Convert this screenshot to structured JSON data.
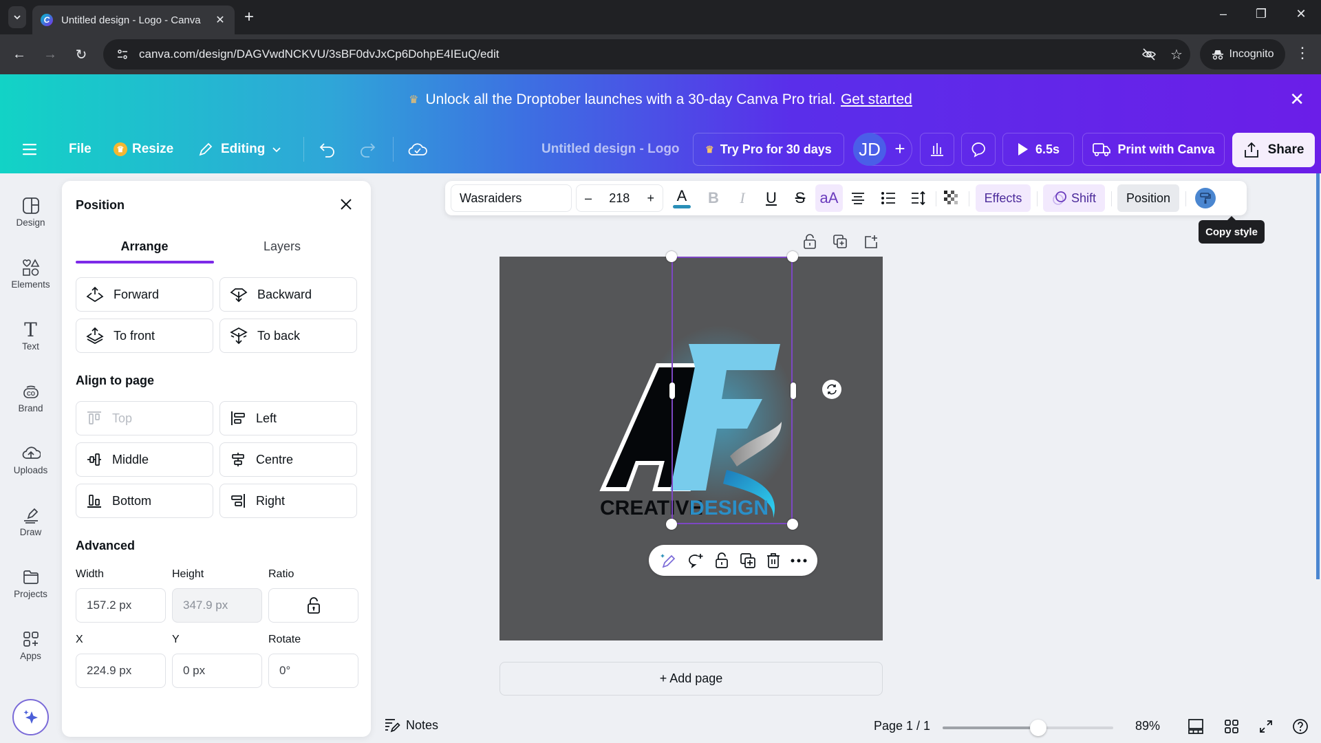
{
  "browser": {
    "tab_title": "Untitled design - Logo - Canva",
    "favicon_letter": "C",
    "url": "canva.com/design/DAGVwdNCKVU/3sBF0dvJxCp6DohpE4IEuQ/edit",
    "incognito_label": "Incognito"
  },
  "banner": {
    "text": "Unlock all the Droptober launches with a 30-day Canva Pro trial.",
    "link": "Get started"
  },
  "toolbar": {
    "file": "File",
    "resize": "Resize",
    "editing": "Editing",
    "doc_title": "Untitled design - Logo",
    "try_pro": "Try Pro for 30 days",
    "avatar_initials": "JD",
    "play_duration": "6.5s",
    "print": "Print with Canva",
    "share": "Share"
  },
  "rail": {
    "items": [
      {
        "label": "Design",
        "icon": "design-icon"
      },
      {
        "label": "Elements",
        "icon": "elements-icon"
      },
      {
        "label": "Text",
        "icon": "text-icon"
      },
      {
        "label": "Brand",
        "icon": "brand-icon"
      },
      {
        "label": "Uploads",
        "icon": "uploads-icon"
      },
      {
        "label": "Draw",
        "icon": "draw-icon"
      },
      {
        "label": "Projects",
        "icon": "projects-icon"
      },
      {
        "label": "Apps",
        "icon": "apps-icon"
      }
    ]
  },
  "panel": {
    "title": "Position",
    "tabs": [
      "Arrange",
      "Layers"
    ],
    "active_tab": "Arrange",
    "arrange": [
      "Forward",
      "Backward",
      "To front",
      "To back"
    ],
    "align_heading": "Align to page",
    "align": [
      "Top",
      "Left",
      "Middle",
      "Centre",
      "Bottom",
      "Right"
    ],
    "advanced_heading": "Advanced",
    "labels": {
      "width": "Width",
      "height": "Height",
      "ratio": "Ratio",
      "x": "X",
      "y": "Y",
      "rotate": "Rotate"
    },
    "values": {
      "width": "157.2 px",
      "height": "347.9 px",
      "x": "224.9 px",
      "y": "0 px",
      "rotate": "0°"
    }
  },
  "text_toolbar": {
    "font": "Wasraiders",
    "size": "218",
    "minus": "–",
    "plus": "+",
    "text_color": "#2a8fb8",
    "effects": "Effects",
    "shift": "Shift",
    "position": "Position",
    "tooltip": "Copy style"
  },
  "canvas": {
    "logo_text_dark": "CREATIVE",
    "logo_text_blue": "DESIGN",
    "add_page": "+ Add page"
  },
  "bottom": {
    "notes": "Notes",
    "page": "Page 1 / 1",
    "zoom_fraction": 0.56,
    "zoom_pct": "89%"
  }
}
